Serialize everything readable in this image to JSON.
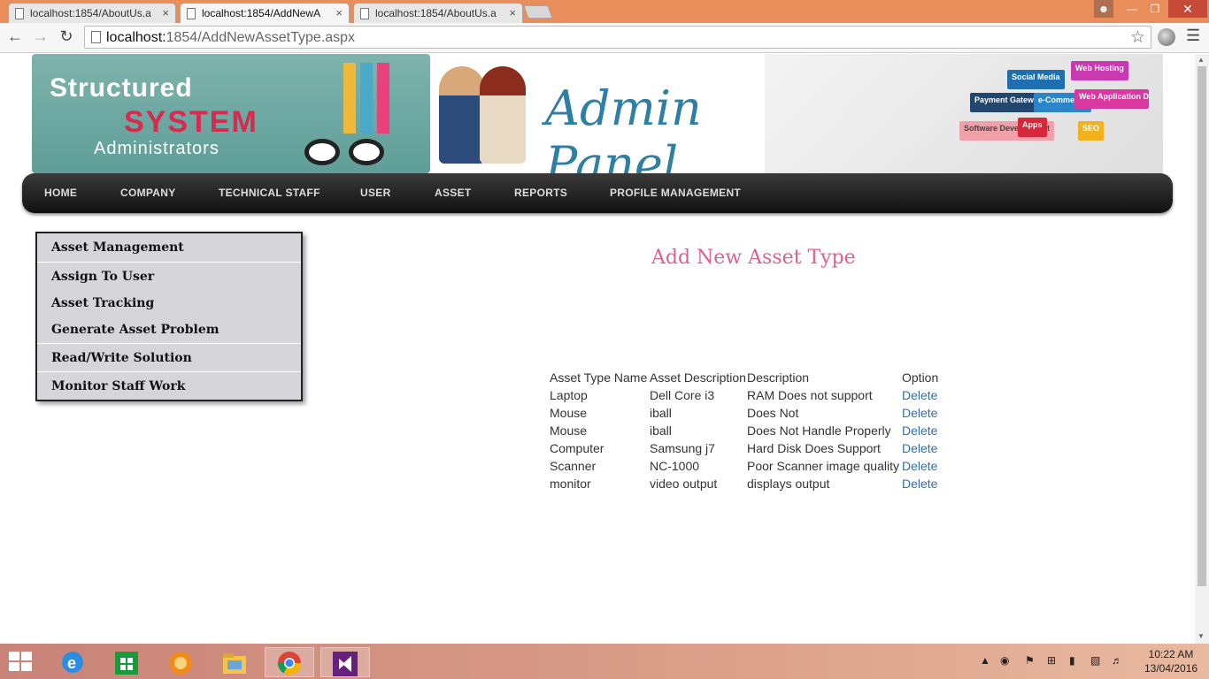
{
  "browser": {
    "tabs": [
      {
        "title": "localhost:1854/AboutUs.a",
        "active": false
      },
      {
        "title": "localhost:1854/AddNewA",
        "active": true
      },
      {
        "title": "localhost:1854/AboutUs.a",
        "active": false
      }
    ],
    "url_host": "localhost:",
    "url_path": "1854/AddNewAssetType.aspx"
  },
  "banner": {
    "logo_line1": "Structured",
    "logo_line2": "SYSTEM",
    "logo_line3": "Administrators",
    "admin_text": "Admin Panel",
    "signs": [
      "Web Hosting",
      "Social Media",
      "Payment Gateways",
      "e-Commerce",
      "Web Application Development",
      "Software Development",
      "Apps",
      "SEO"
    ]
  },
  "nav": {
    "items": [
      "HOME",
      "COMPANY",
      "TECHNICAL STAFF",
      "USER",
      "ASSET",
      "REPORTS",
      "PROFILE MANAGEMENT"
    ]
  },
  "sidemenu": {
    "items": [
      "Asset Management",
      "Assign To User",
      "Asset Tracking",
      "Generate Asset Problem",
      "Read/Write Solution",
      "Monitor Staff Work"
    ]
  },
  "page": {
    "title": "Add New Asset Type"
  },
  "table": {
    "headers": [
      "Asset Type Name",
      "Asset Description",
      "Description",
      "Option"
    ],
    "rows": [
      [
        "Laptop",
        "Dell Core i3",
        "RAM Does not support",
        "Delete"
      ],
      [
        "Mouse",
        "iball",
        "Does Not",
        "Delete"
      ],
      [
        "Mouse",
        "iball",
        "Does Not Handle Properly",
        "Delete"
      ],
      [
        "Computer",
        "Samsung j7",
        "Hard Disk Does Support",
        "Delete"
      ],
      [
        "Scanner",
        "NC-1000",
        "Poor Scanner image quality",
        "Delete"
      ],
      [
        "monitor",
        "video output",
        "displays output",
        "Delete"
      ]
    ]
  },
  "taskbar": {
    "time": "10:22 AM",
    "date": "13/04/2016"
  },
  "colors": {
    "title_pink": "#e0608a",
    "link_blue": "#2e6fb0",
    "tab_strip": "#e98d5a"
  }
}
